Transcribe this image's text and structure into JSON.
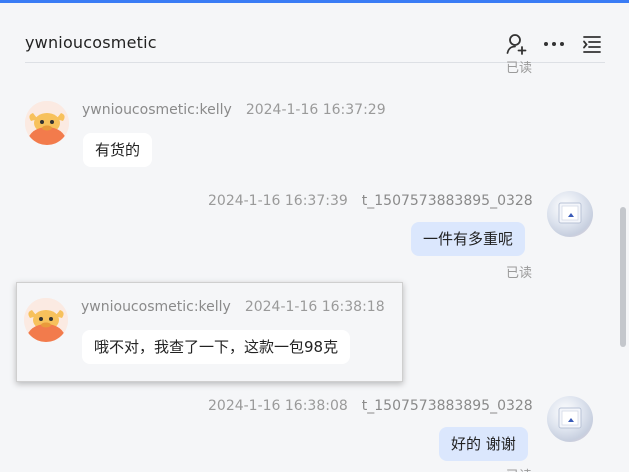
{
  "header": {
    "title": "ywnioucosmetic",
    "icons": [
      "add-user-icon",
      "more-icon",
      "list-menu-icon"
    ]
  },
  "colors": {
    "accent": "#3a7cf5",
    "outgoing_bubble": "#dbe7fd",
    "incoming_bubble": "#ffffff",
    "avatar_cow": "#f27b4c"
  },
  "chat": {
    "top_read_label": "已读",
    "messages": [
      {
        "direction": "in",
        "sender": "ywnioucosmetic:kelly",
        "time": "2024-1-16 16:37:29",
        "text": "有货的"
      },
      {
        "direction": "out",
        "sender": "t_1507573883895_0328",
        "time": "2024-1-16 16:37:39",
        "text": "一件有多重呢",
        "status": "已读"
      },
      {
        "direction": "in",
        "sender": "ywnioucosmetic:kelly",
        "time": "2024-1-16 16:38:18",
        "text": "哦不对，我查了一下，这款一包98克"
      },
      {
        "direction": "out",
        "sender": "t_1507573883895_0328",
        "time": "2024-1-16 16:38:08",
        "text": "好的 谢谢",
        "status": "已读"
      }
    ]
  }
}
